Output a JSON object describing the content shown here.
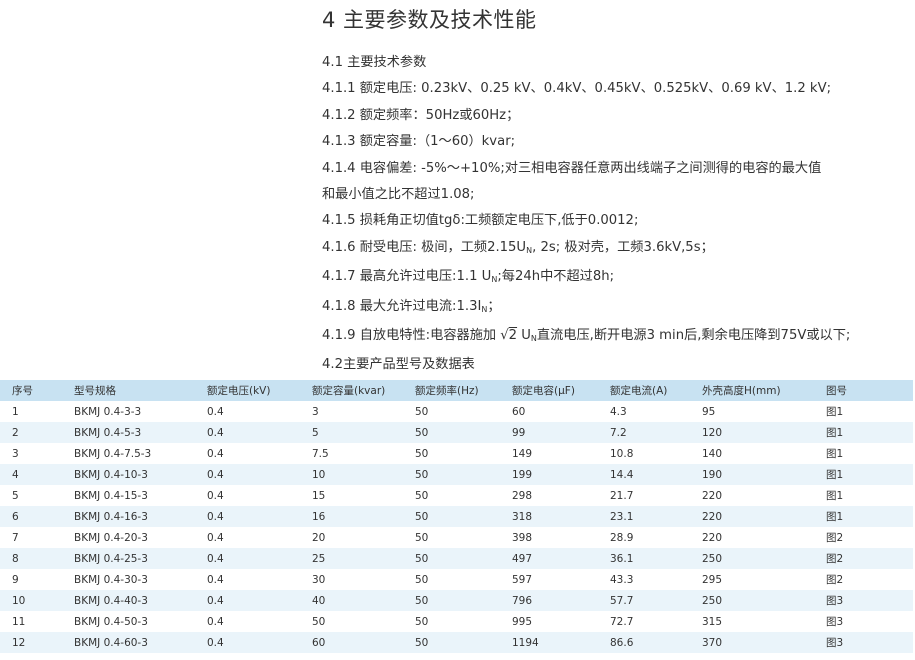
{
  "title": "4 主要参数及技术性能",
  "sections": {
    "s41": "4.1 主要技术参数",
    "s411": "4.1.1 额定电压: 0.23kV、0.25 kV、0.4kV、0.45kV、0.525kV、0.69 kV、1.2 kV;",
    "s412": "4.1.2 额定频率：50Hz或60Hz；",
    "s413": "4.1.3 额定容量:（1～60）kvar;",
    "s414a": "4.1.4 电容偏差: -5%～+10%;对三相电容器任意两出线端子之间测得的电容的最大值",
    "s414b": "和最小值之比不超过1.08;",
    "s415": "4.1.5 损耗角正切值tgδ:工频额定电压下,低于0.0012;",
    "s416_pre": "4.1.6 耐受电压:  极间，工频2.15U",
    "s416_sub": "N",
    "s416_post": ", 2s; 极对壳，工频3.6kV,5s；",
    "s417_pre": "4.1.7 最高允许过电压:1.1 U",
    "s417_sub": "N",
    "s417_post": ";每24h中不超过8h;",
    "s418_pre": "4.1.8 最大允许过电流:1.3I",
    "s418_sub": "N",
    "s418_post": "；",
    "s419_pre": "4.1.9 自放电特性:电容器施加 ",
    "s419_radical": "2",
    "s419_mid": " U",
    "s419_sub": "N",
    "s419_post": "直流电压,断开电源3 min后,剩余电压降到75V或以下;",
    "s42": "4.2主要产品型号及数据表"
  },
  "table": {
    "headers": [
      "序号",
      "型号规格",
      "额定电压(kV)",
      "额定容量(kvar)",
      "额定频率(Hz)",
      "额定电容(μF)",
      "额定电流(A)",
      "外壳高度H(mm)",
      "图号"
    ],
    "rows": [
      [
        "1",
        "BKMJ 0.4-3-3",
        "0.4",
        "3",
        "50",
        "60",
        "4.3",
        "95",
        "图1"
      ],
      [
        "2",
        "BKMJ 0.4-5-3",
        "0.4",
        "5",
        "50",
        "99",
        "7.2",
        "120",
        "图1"
      ],
      [
        "3",
        "BKMJ 0.4-7.5-3",
        "0.4",
        "7.5",
        "50",
        "149",
        "10.8",
        "140",
        "图1"
      ],
      [
        "4",
        "BKMJ 0.4-10-3",
        "0.4",
        "10",
        "50",
        "199",
        "14.4",
        "190",
        "图1"
      ],
      [
        "5",
        "BKMJ 0.4-15-3",
        "0.4",
        "15",
        "50",
        "298",
        "21.7",
        "220",
        "图1"
      ],
      [
        "6",
        "BKMJ 0.4-16-3",
        "0.4",
        "16",
        "50",
        "318",
        "23.1",
        "220",
        "图1"
      ],
      [
        "7",
        "BKMJ 0.4-20-3",
        "0.4",
        "20",
        "50",
        "398",
        "28.9",
        "220",
        "图2"
      ],
      [
        "8",
        "BKMJ 0.4-25-3",
        "0.4",
        "25",
        "50",
        "497",
        "36.1",
        "250",
        "图2"
      ],
      [
        "9",
        "BKMJ 0.4-30-3",
        "0.4",
        "30",
        "50",
        "597",
        "43.3",
        "295",
        "图2"
      ],
      [
        "10",
        "BKMJ 0.4-40-3",
        "0.4",
        "40",
        "50",
        "796",
        "57.7",
        "250",
        "图3"
      ],
      [
        "11",
        "BKMJ 0.4-50-3",
        "0.4",
        "50",
        "50",
        "995",
        "72.7",
        "315",
        "图3"
      ],
      [
        "12",
        "BKMJ 0.4-60-3",
        "0.4",
        "60",
        "50",
        "1194",
        "86.6",
        "370",
        "图3"
      ]
    ]
  }
}
